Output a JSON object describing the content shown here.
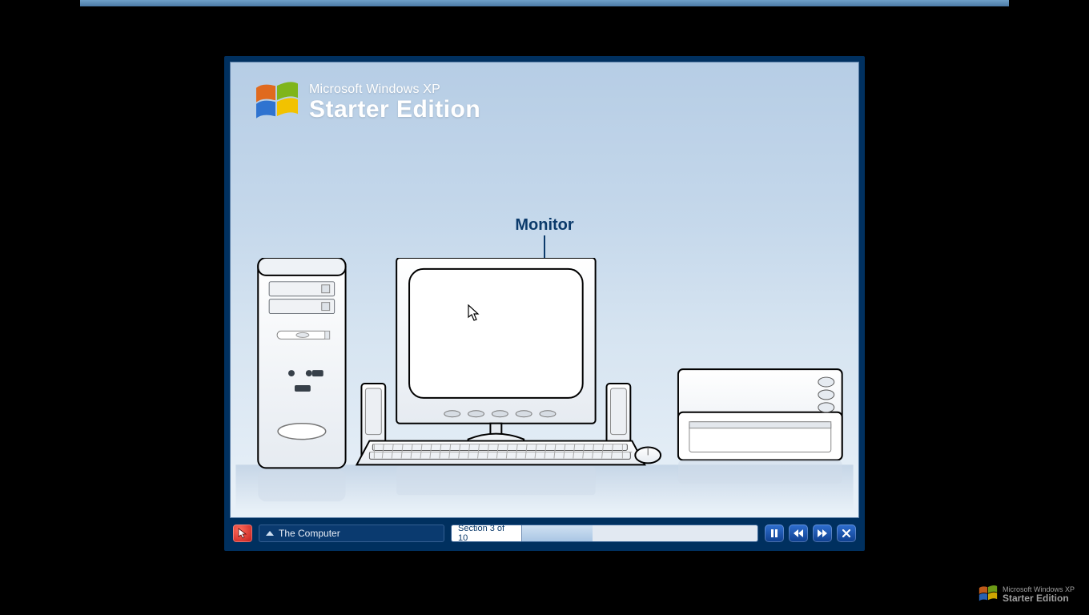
{
  "branding": {
    "super": "Microsoft Windows XP",
    "main": "Starter Edition"
  },
  "diagram": {
    "label": "Monitor"
  },
  "controls": {
    "section_title": "The Computer",
    "progress_label": "Section 3 of 10",
    "progress_percent": 30,
    "buttons": {
      "cursor_icon": "cursor-icon",
      "pause": "pause-icon",
      "rewind": "rewind-icon",
      "forward": "forward-icon",
      "close": "close-icon"
    }
  },
  "watermark": {
    "super": "Microsoft Windows XP",
    "main": "Starter Edition"
  }
}
